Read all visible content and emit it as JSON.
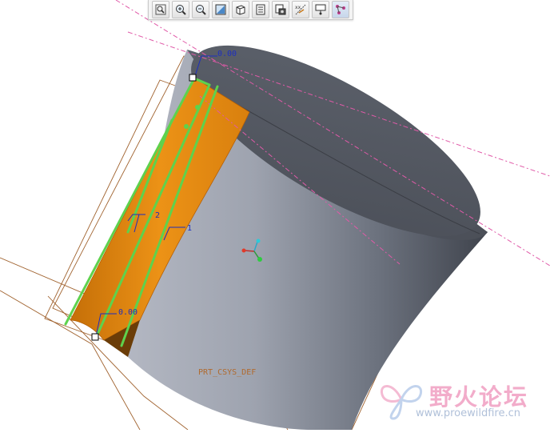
{
  "toolbar": {
    "buttons": [
      {
        "icon": "refit-icon"
      },
      {
        "icon": "zoom-in-icon"
      },
      {
        "icon": "zoom-out-icon"
      },
      {
        "icon": "repaint-icon"
      },
      {
        "icon": "shading-icon"
      },
      {
        "icon": "saved-views-icon"
      },
      {
        "icon": "layers-icon"
      },
      {
        "icon": "datum-display-icon"
      },
      {
        "icon": "annotation-display-icon"
      },
      {
        "icon": "spin-center-icon"
      }
    ]
  },
  "model": {
    "dim_top": "0.00",
    "dim_bottom": "0.00",
    "dim_2": "2",
    "dim_1": "1",
    "part_label": "PRT_CSYS_DEF"
  },
  "watermark": {
    "title": "野火论坛",
    "url": "www.proewildfire.cn"
  },
  "colors": {
    "body_shade": "#6e7583",
    "surface_orange": "#e88c12",
    "sketch_green": "#5ed24d",
    "datum_brown": "#a0622e",
    "dim_blue": "#1d2fbf"
  }
}
